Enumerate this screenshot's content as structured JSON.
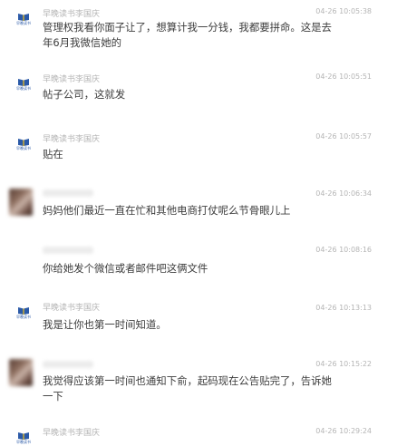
{
  "brand": {
    "logo_text": "早晚读书",
    "logo_color": "#2b5aa8",
    "accent_yellow": "#f2c21b"
  },
  "messages": [
    {
      "sender": "早晚读书李国庆",
      "avatar": "logo",
      "time": "04-26 10:05:38",
      "text": "管理权我看你面子让了，想算计我一分钱，我都要拼命。这是去年6月我微信她的"
    },
    {
      "sender": "早晚读书李国庆",
      "avatar": "logo",
      "time": "04-26 10:05:51",
      "text": "帖子公司，这就发"
    },
    {
      "sender": "早晚读书李国庆",
      "avatar": "logo",
      "time": "04-26 10:05:57",
      "text": "贴在"
    },
    {
      "sender": "",
      "avatar": "photo",
      "time": "04-26 10:06:34",
      "text": "妈妈他们最近一直在忙和其他电商打仗呢么节骨眼儿上"
    },
    {
      "sender": "",
      "avatar": "none",
      "time": "04-26 10:08:16",
      "text": "你给她发个微信或者邮件吧这俩文件"
    },
    {
      "sender": "早晚读书李国庆",
      "avatar": "logo",
      "time": "04-26 10:13:13",
      "text": "我是让你也第一时间知道。"
    },
    {
      "sender": "",
      "avatar": "photo",
      "time": "04-26 10:15:22",
      "text": "我觉得应该第一时间也通知下俞，起码现在公告贴完了，告诉她一下"
    },
    {
      "sender": "早晚读书李国庆",
      "avatar": "logo",
      "time": "04-26 10:29:24",
      "text": ""
    }
  ]
}
